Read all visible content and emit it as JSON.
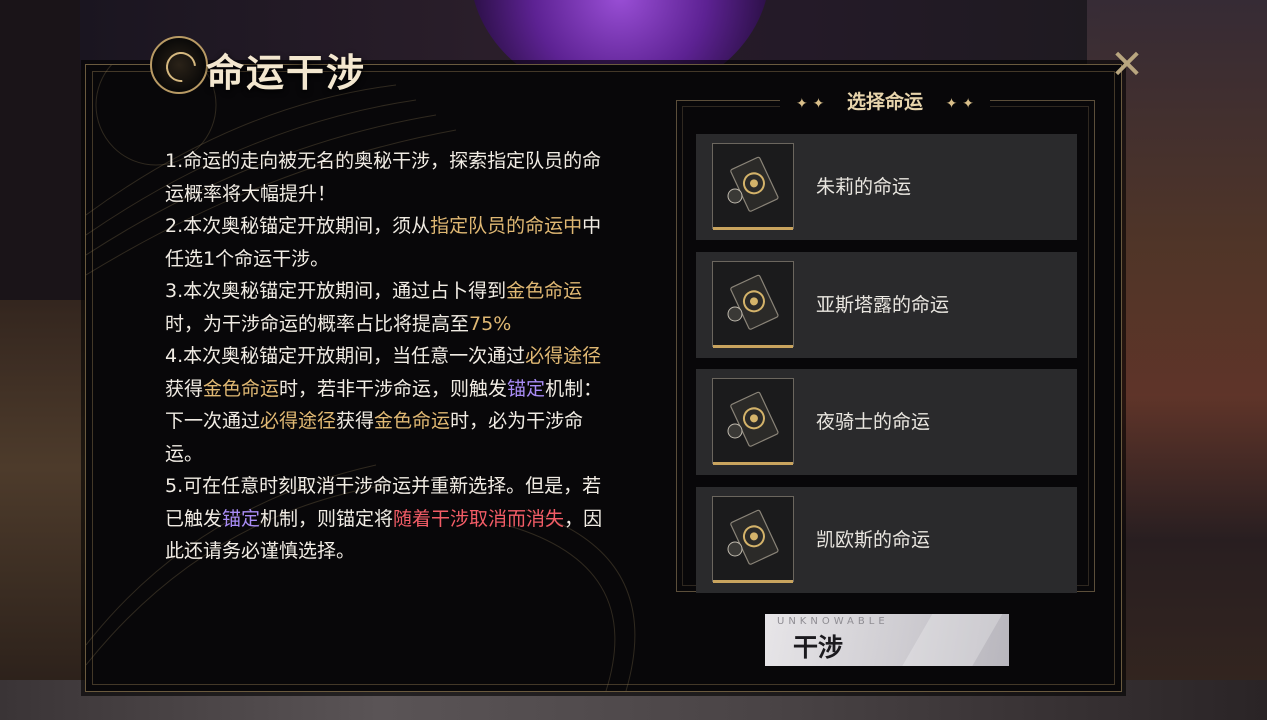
{
  "title": "命运干涉",
  "close_label": "✕",
  "description": [
    [
      {
        "t": "1.命运的走向被无名的奥秘干涉，探索指定队员的命运概率将大幅提升！",
        "c": ""
      }
    ],
    [
      {
        "t": "2.本次奥秘锚定开放期间，须从",
        "c": ""
      },
      {
        "t": "指定队员的命运中",
        "c": "gold"
      },
      {
        "t": "中任选1个命运干涉。",
        "c": ""
      }
    ],
    [
      {
        "t": "3.本次奥秘锚定开放期间，通过占卜得到",
        "c": ""
      },
      {
        "t": "金色命运",
        "c": "gold"
      },
      {
        "t": "时，为干涉命运的概率占比将提高至",
        "c": ""
      },
      {
        "t": "75%",
        "c": "gold"
      }
    ],
    [
      {
        "t": "4.本次奥秘锚定开放期间，当任意一次通过",
        "c": ""
      },
      {
        "t": "必得途径",
        "c": "gold"
      },
      {
        "t": "获得",
        "c": ""
      },
      {
        "t": "金色命运",
        "c": "gold"
      },
      {
        "t": "时，若非干涉命运，则触发",
        "c": ""
      },
      {
        "t": "锚定",
        "c": "purple"
      },
      {
        "t": "机制：下一次通过",
        "c": ""
      },
      {
        "t": "必得途径",
        "c": "gold"
      },
      {
        "t": "获得",
        "c": ""
      },
      {
        "t": "金色命运",
        "c": "gold"
      },
      {
        "t": "时，必为干涉命运。",
        "c": ""
      }
    ],
    [
      {
        "t": "5.可在任意时刻取消干涉命运并重新选择。但是，若已触发",
        "c": ""
      },
      {
        "t": "锚定",
        "c": "purple"
      },
      {
        "t": "机制，则锚定将",
        "c": ""
      },
      {
        "t": "随着干涉取消而消失",
        "c": "red"
      },
      {
        "t": "，因此还请务必谨慎选择。",
        "c": ""
      }
    ]
  ],
  "select": {
    "header": "选择命运",
    "star_left": "✦ ✦",
    "star_right": "✦ ✦",
    "items": [
      {
        "label": "朱莉的命运"
      },
      {
        "label": "亚斯塔露的命运"
      },
      {
        "label": "夜骑士的命运"
      },
      {
        "label": "凯欧斯的命运"
      }
    ]
  },
  "button": {
    "sub": "UNKNOWABLE",
    "label": "干涉"
  },
  "colors": {
    "gold": "#e0b873",
    "purple": "#a98cf5",
    "red": "#f25c66",
    "item_bg": "#2a2a2c"
  }
}
